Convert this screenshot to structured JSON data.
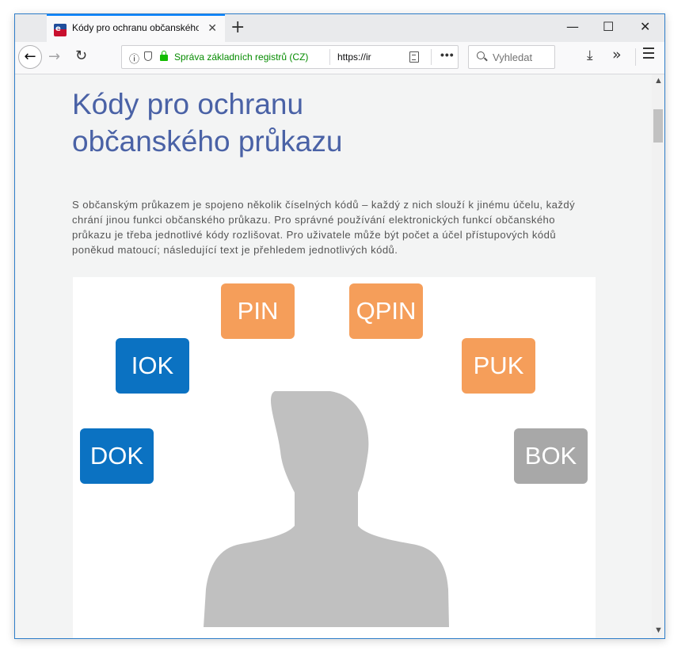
{
  "tab": {
    "title": "Kódy pro ochranu občanského průkazu",
    "favicon_letter": "e"
  },
  "window_controls": {
    "new_tab": "+",
    "minimize": "—",
    "maximize": "☐",
    "close": "✕"
  },
  "navigation": {
    "back_glyph": "←",
    "forward_glyph": "→",
    "reload_glyph": "↻",
    "url_identity": "Správa základních registrů (CZ)",
    "url_text": "https://ir",
    "page_actions": "•••",
    "search_placeholder": "Vyhledat",
    "download_glyph": "⤓",
    "overflow_glyph": "»"
  },
  "page": {
    "title": "Kódy pro ochranu občanského průkazu",
    "intro": "S občanským průkazem je spojeno několik číselných kódů – každý z nich slouží k jinému účelu, každý chrání jinou funkci občanského průkazu. Pro správné používání elektronických funkcí občanského průkazu je třeba jednotlivé kódy rozlišovat. Pro uživatele může být počet a účel přístupových kódů poněkud matoucí; následující text je přehledem jednotlivých kódů."
  },
  "figure": {
    "codes": [
      {
        "label": "PIN",
        "color": "#f59e5a"
      },
      {
        "label": "QPIN",
        "color": "#f59e5a"
      },
      {
        "label": "IOK",
        "color": "#0b72c2"
      },
      {
        "label": "PUK",
        "color": "#f59e5a"
      },
      {
        "label": "DOK",
        "color": "#0b72c2"
      },
      {
        "label": "BOK",
        "color": "#a8a8a8"
      }
    ],
    "silhouette_color": "#c0c0c0"
  },
  "colors": {
    "title": "#4a62a6",
    "secure_identity": "#058b00",
    "tab_accent": "#0a84ff"
  }
}
